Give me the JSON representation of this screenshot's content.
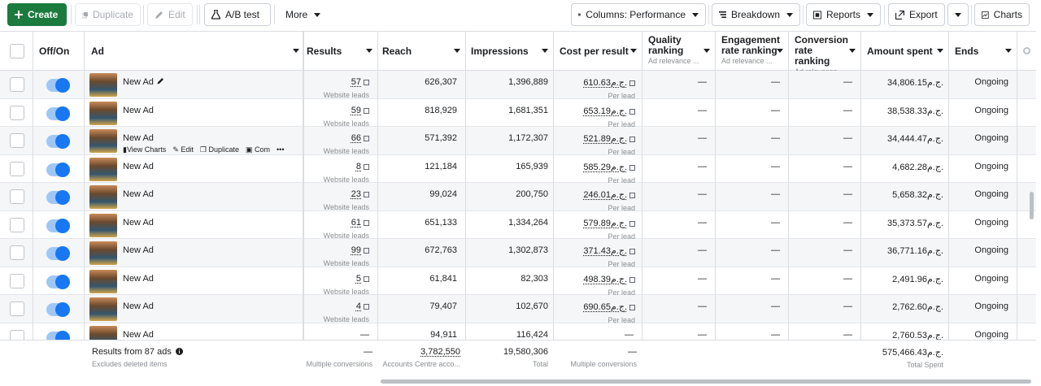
{
  "toolbar": {
    "create": "Create",
    "duplicate": "Duplicate",
    "edit": "Edit",
    "ab_test": "A/B test",
    "more": "More",
    "columns": "Columns: Performance",
    "breakdown": "Breakdown",
    "reports": "Reports",
    "export": "Export",
    "charts": "Charts"
  },
  "headers": {
    "offon": "Off/On",
    "ad": "Ad",
    "results": "Results",
    "reach": "Reach",
    "impressions": "Impressions",
    "cost": "Cost per result",
    "quality": "Quality ranking",
    "quality_sub": "Ad relevance ...",
    "engagement": "Engagement rate ranking",
    "engagement_sub": "Ad relevance ...",
    "conversion": "Conversion rate ranking",
    "conversion_sub": "Ad relevance ...",
    "amount": "Amount spent",
    "ends": "Ends"
  },
  "rows": [
    {
      "name": "New Ad",
      "results": "57",
      "results_sub": "Website leads",
      "reach": "626,307",
      "impressions": "1,396,889",
      "cost": "610.63ج.م.",
      "cost_sub": "Per lead",
      "quality": "—",
      "engagement": "—",
      "conversion": "—",
      "amount": "34,806.15ج.م.",
      "ends": "Ongoing"
    },
    {
      "name": "New Ad",
      "results": "59",
      "results_sub": "Website leads",
      "reach": "818,929",
      "impressions": "1,681,351",
      "cost": "653.19ج.م.",
      "cost_sub": "Per lead",
      "quality": "—",
      "engagement": "—",
      "conversion": "—",
      "amount": "38,538.33ج.م.",
      "ends": "Ongoing"
    },
    {
      "name": "New Ad",
      "results": "66",
      "results_sub": "Website leads",
      "reach": "571,392",
      "impressions": "1,172,307",
      "cost": "521.89ج.م.",
      "cost_sub": "Per lead",
      "quality": "—",
      "engagement": "—",
      "conversion": "—",
      "amount": "34,444.47ج.م.",
      "ends": "Ongoing"
    },
    {
      "name": "New Ad",
      "results": "8",
      "results_sub": "Website leads",
      "reach": "121,184",
      "impressions": "165,939",
      "cost": "585.29ج.م.",
      "cost_sub": "Per lead",
      "quality": "—",
      "engagement": "—",
      "conversion": "—",
      "amount": "4,682.28ج.م.",
      "ends": "Ongoing"
    },
    {
      "name": "New Ad",
      "results": "23",
      "results_sub": "Website leads",
      "reach": "99,024",
      "impressions": "200,750",
      "cost": "246.01ج.م.",
      "cost_sub": "Per lead",
      "quality": "—",
      "engagement": "—",
      "conversion": "—",
      "amount": "5,658.32ج.م.",
      "ends": "Ongoing"
    },
    {
      "name": "New Ad",
      "results": "61",
      "results_sub": "Website leads",
      "reach": "651,133",
      "impressions": "1,334,264",
      "cost": "579.89ج.م.",
      "cost_sub": "Per lead",
      "quality": "—",
      "engagement": "—",
      "conversion": "—",
      "amount": "35,373.57ج.م.",
      "ends": "Ongoing"
    },
    {
      "name": "New Ad",
      "results": "99",
      "results_sub": "Website leads",
      "reach": "672,763",
      "impressions": "1,302,873",
      "cost": "371.43ج.م.",
      "cost_sub": "Per lead",
      "quality": "—",
      "engagement": "—",
      "conversion": "—",
      "amount": "36,771.16ج.م.",
      "ends": "Ongoing"
    },
    {
      "name": "New Ad",
      "results": "5",
      "results_sub": "Website leads",
      "reach": "61,841",
      "impressions": "82,303",
      "cost": "498.39ج.م.",
      "cost_sub": "Per lead",
      "quality": "—",
      "engagement": "—",
      "conversion": "—",
      "amount": "2,491.96ج.م.",
      "ends": "Ongoing"
    },
    {
      "name": "New Ad",
      "results": "4",
      "results_sub": "Website leads",
      "reach": "79,407",
      "impressions": "102,670",
      "cost": "690.65ج.م.",
      "cost_sub": "Per lead",
      "quality": "—",
      "engagement": "—",
      "conversion": "—",
      "amount": "2,762.60ج.م.",
      "ends": "Ongoing"
    },
    {
      "name": "New Ad",
      "results": "—",
      "results_sub": "",
      "reach": "94,911",
      "impressions": "116,424",
      "cost": "—",
      "cost_sub": "",
      "quality": "—",
      "engagement": "—",
      "conversion": "—",
      "amount": "2,760.53ج.م.",
      "ends": "Ongoing"
    }
  ],
  "row_actions": {
    "view_charts": "View Charts",
    "edit": "Edit",
    "duplicate": "Duplicate",
    "compare": "Com",
    "more": "•••"
  },
  "footer": {
    "results_from": "Results from 87 ads",
    "excludes": "Excludes deleted items",
    "results": "—",
    "results_sub": "Multiple conversions",
    "reach": "3,782,550",
    "reach_sub": "Accounts Centre acco...",
    "impressions": "19,580,306",
    "impressions_sub": "Total",
    "cost": "—",
    "cost_sub": "Multiple conversions",
    "amount": "575,466.43ج.م.",
    "amount_sub": "Total Spent"
  },
  "colors": {
    "create_green": "#1b7a3e",
    "toggle_blue": "#1877f2"
  }
}
